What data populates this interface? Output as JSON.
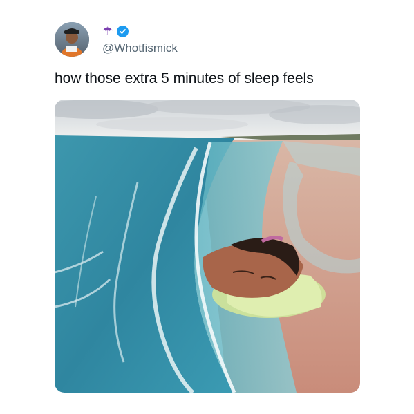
{
  "tweet": {
    "display_name_emoji": "☂",
    "verified": true,
    "handle": "@Whotfismick",
    "text": "how those extra 5 minutes of sleep feels"
  },
  "colors": {
    "handle": "#536471",
    "text": "#0f1419",
    "verified": "#1d9bf0",
    "umbrella": "#7b3fb0"
  },
  "media": {
    "description_icon": "beach-photo-image"
  }
}
